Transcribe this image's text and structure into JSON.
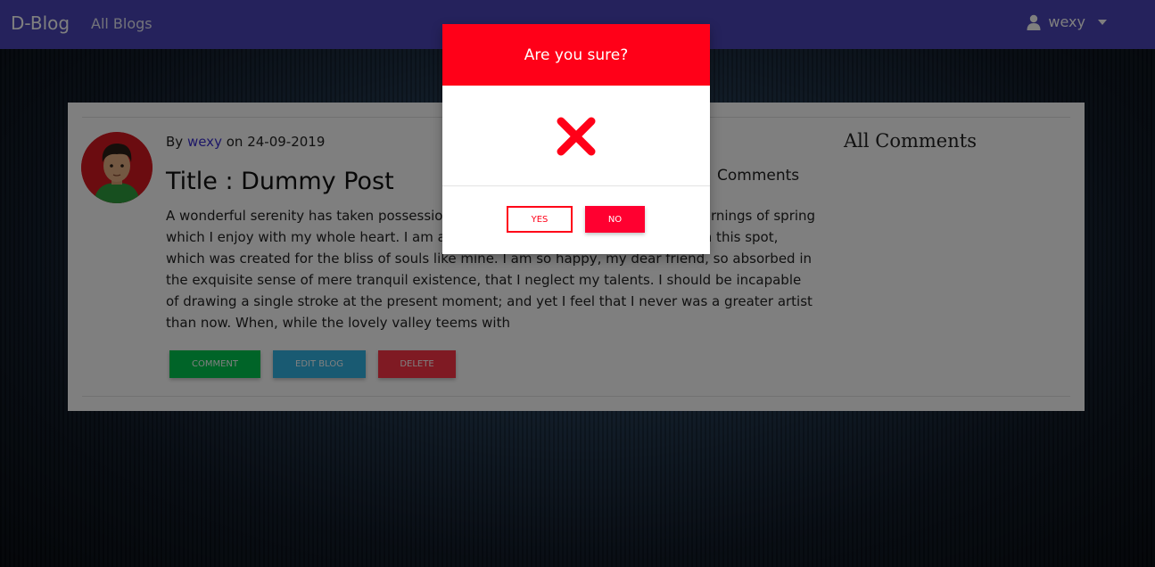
{
  "navbar": {
    "brand": "D-Blog",
    "all_blogs_link": "All Blogs",
    "user_name": "wexy",
    "bg_color": "#4a45b8"
  },
  "post": {
    "by_label": "By",
    "author": "wexy",
    "on_label": "on",
    "date": "24-09-2019",
    "title": "Title : Dummy Post",
    "body": "A wonderful serenity has taken possession of my entire soul, like these sweet mornings of spring which I enjoy with my whole heart. I am alone, and feel the charm of existence in this spot, which was created for the bliss of souls like mine. I am so happy, my dear friend, so absorbed in the exquisite sense of mere tranquil existence, that I neglect my talents. I should be incapable of drawing a single stroke at the present moment; and yet I feel that I never was a greater artist than now. When, while the lovely valley teems with",
    "buttons": {
      "comment": "COMMENT",
      "edit": "EDIT BLOG",
      "delete": "DELETE"
    },
    "comments_label": "Comments"
  },
  "sidebar": {
    "all_comments_title": "All Comments"
  },
  "modal": {
    "title": "Are you sure?",
    "icon": "x-mark-icon",
    "yes_label": "YES",
    "no_label": "NO",
    "accent_color": "#ff0018"
  }
}
